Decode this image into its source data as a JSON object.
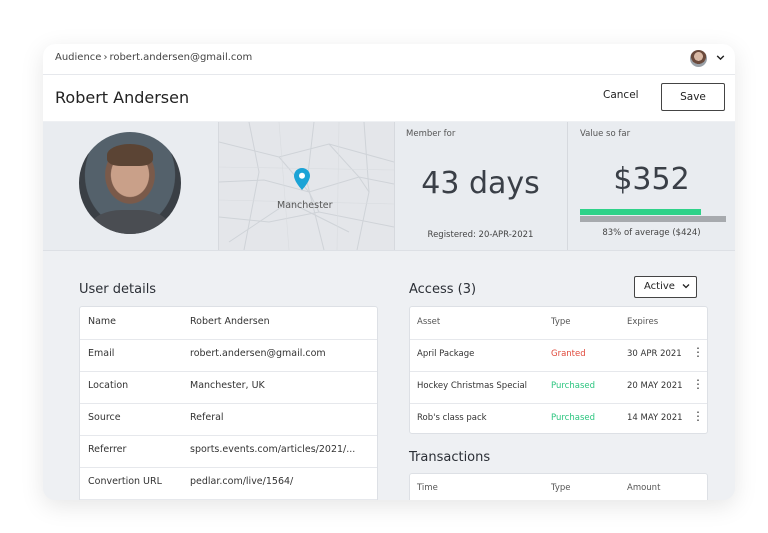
{
  "breadcrumb": {
    "root": "Audience",
    "separator": "›",
    "current": "robert.andersen@gmail.com"
  },
  "header": {
    "title": "Robert Andersen",
    "cancel_label": "Cancel",
    "save_label": "Save"
  },
  "icons": {
    "user_menu": "chevron-down-icon",
    "map_pin": "map-pin-icon",
    "row_menu": "more-vertical-icon"
  },
  "map": {
    "city_label": "Manchester"
  },
  "stats": {
    "member": {
      "label": "Member for",
      "value": "43 days",
      "sub": "Registered: 20-APR-2021"
    },
    "value": {
      "label": "Value so far",
      "value": "$352",
      "sub": "83% of average ($424)",
      "progress_fraction": 0.83
    }
  },
  "colors": {
    "progress": "#2fd289",
    "track": "#a7aaae",
    "pin": "#1ba3d6",
    "granted": "#e04a3c",
    "purchased": "#2bc57f"
  },
  "user_details": {
    "title": "User details",
    "rows": [
      {
        "key": "Name",
        "value": "Robert Andersen"
      },
      {
        "key": "Email",
        "value": "robert.andersen@gmail.com"
      },
      {
        "key": "Location",
        "value": "Manchester, UK"
      },
      {
        "key": "Source",
        "value": "Referal"
      },
      {
        "key": "Referrer",
        "value": "sports.events.com/articles/2021/..."
      },
      {
        "key": "Convertion URL",
        "value": "pedlar.com/live/1564/"
      }
    ]
  },
  "access": {
    "title": "Access (3)",
    "filter_label": "Active",
    "columns": [
      "Asset",
      "Type",
      "Expires"
    ],
    "rows": [
      {
        "asset": "April Package",
        "type": "Granted",
        "expires": "30 APR 2021"
      },
      {
        "asset": "Hockey Christmas Special",
        "type": "Purchased",
        "expires": "20 MAY 2021"
      },
      {
        "asset": "Rob's class pack",
        "type": "Purchased",
        "expires": "14 MAY 2021"
      }
    ]
  },
  "transactions": {
    "title": "Transactions",
    "columns": [
      "Time",
      "Type",
      "Amount"
    ]
  }
}
